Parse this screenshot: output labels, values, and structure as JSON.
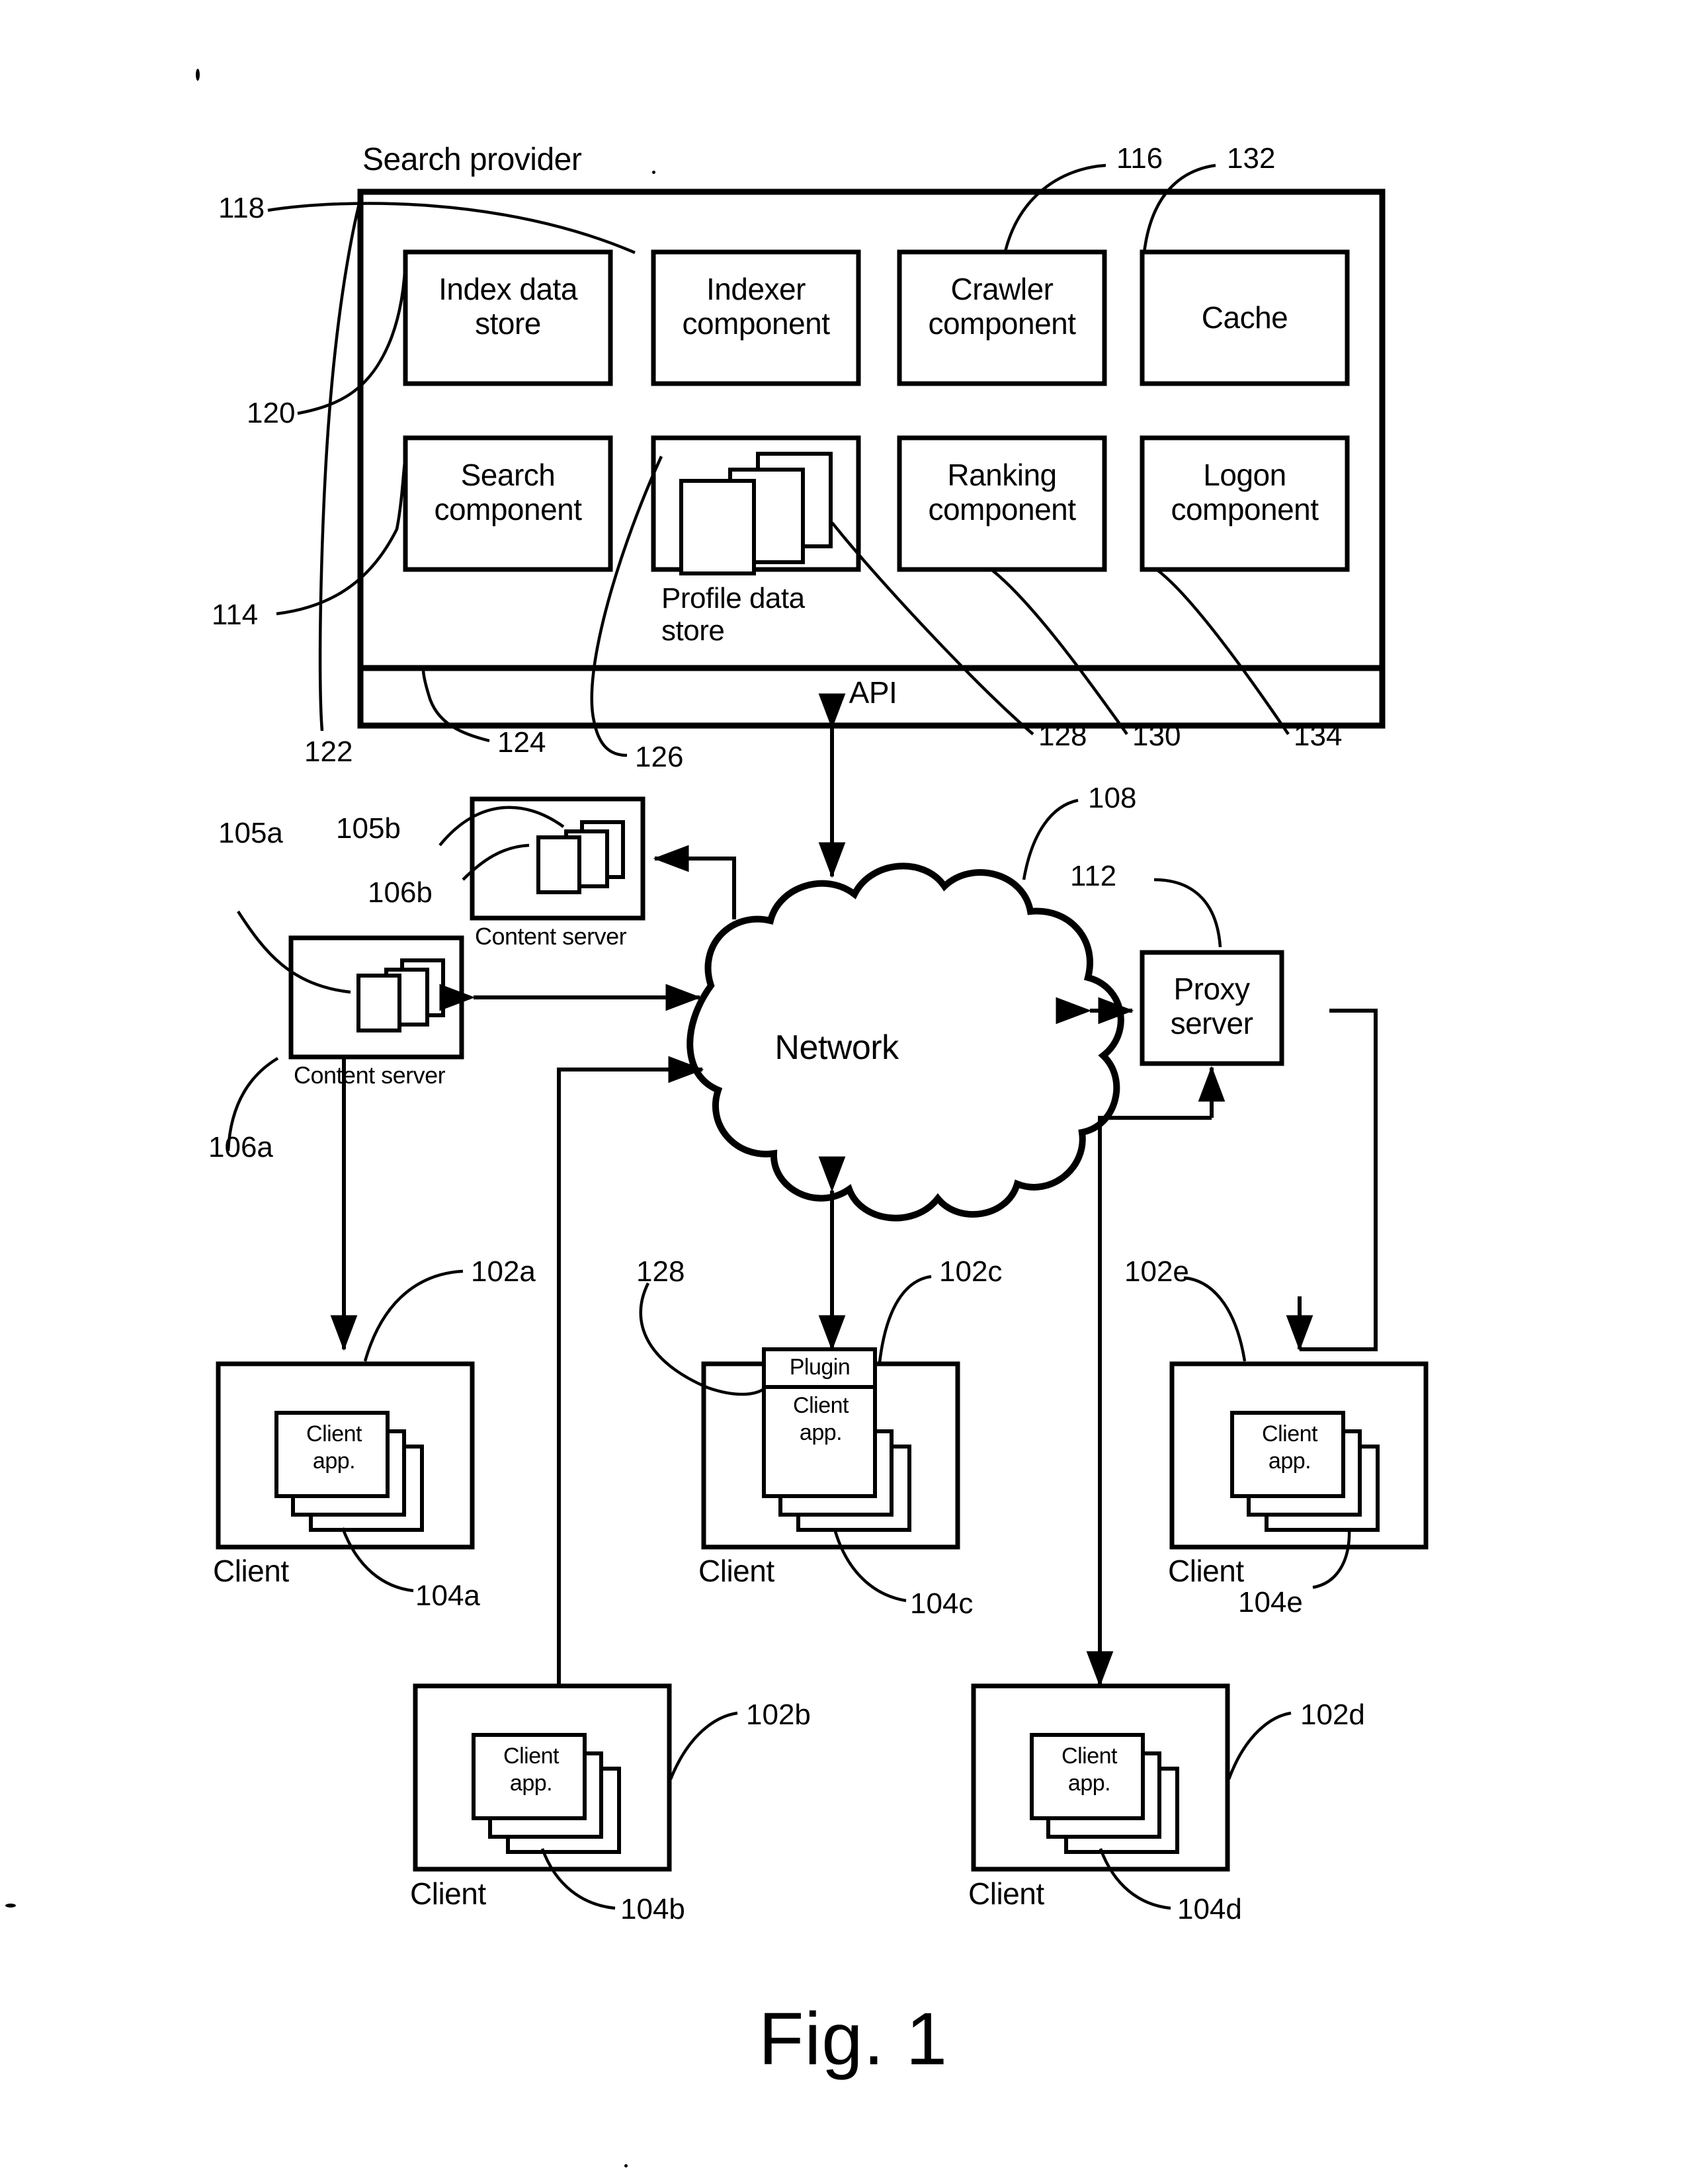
{
  "figure": {
    "caption": "Fig. 1",
    "title": "Search provider"
  },
  "search_provider": {
    "label": "Search provider",
    "ref_container": "118",
    "ref_left_bracket_top": "120",
    "ref_left_bracket_bottom": "114",
    "api_bar": {
      "label": "API",
      "ref": "122"
    },
    "boxes": [
      {
        "id": "index-data-store",
        "label": "Index data\nstore",
        "ref": "120"
      },
      {
        "id": "indexer-component",
        "label": "Indexer\ncomponent",
        "ref": "118"
      },
      {
        "id": "crawler-component",
        "label": "Crawler\ncomponent",
        "ref": "116"
      },
      {
        "id": "cache",
        "label": "Cache",
        "ref": "132"
      },
      {
        "id": "search-component",
        "label": "Search\ncomponent",
        "ref": "114"
      },
      {
        "id": "profile-data-store",
        "label": "Profile data\nstore",
        "ref": "126"
      },
      {
        "id": "ranking-component",
        "label": "Ranking\ncomponent",
        "ref": "130"
      },
      {
        "id": "logon-component",
        "label": "Logon\ncomponent",
        "ref": "134"
      }
    ],
    "ref_numbers": [
      "118",
      "120",
      "114",
      "122",
      "124",
      "126",
      "128",
      "130",
      "134",
      "116",
      "132"
    ]
  },
  "network": {
    "label": "Network",
    "ref": "108"
  },
  "proxy_server": {
    "label": "Proxy\nserver",
    "ref": "112"
  },
  "content_servers": [
    {
      "id": "content-server-b",
      "label": "Content server",
      "ref_box": "105b",
      "ref_docs": "106b"
    },
    {
      "id": "content-server-a",
      "label": "Content server",
      "ref_box": "105a",
      "ref_docs": "106a"
    }
  ],
  "clients": [
    {
      "id": "client-a",
      "label": "Client",
      "app_label": "Client\napp.",
      "ref_box": "102a",
      "ref_app": "104a",
      "plugin": null
    },
    {
      "id": "client-c",
      "label": "Client",
      "app_label": "Client\napp.",
      "ref_box": "102c",
      "ref_app": "104c",
      "plugin": "Plugin",
      "ref_plugin": "128"
    },
    {
      "id": "client-e",
      "label": "Client",
      "app_label": "Client\napp.",
      "ref_box": "102e",
      "ref_app": "104e",
      "plugin": null
    },
    {
      "id": "client-b",
      "label": "Client",
      "app_label": "Client\napp.",
      "ref_box": "102b",
      "ref_app": "104b",
      "plugin": null
    },
    {
      "id": "client-d",
      "label": "Client",
      "app_label": "Client\napp.",
      "ref_box": "102d",
      "ref_app": "104d",
      "plugin": null
    }
  ],
  "colors": {
    "ink": "#000000",
    "paper": "#ffffff"
  }
}
